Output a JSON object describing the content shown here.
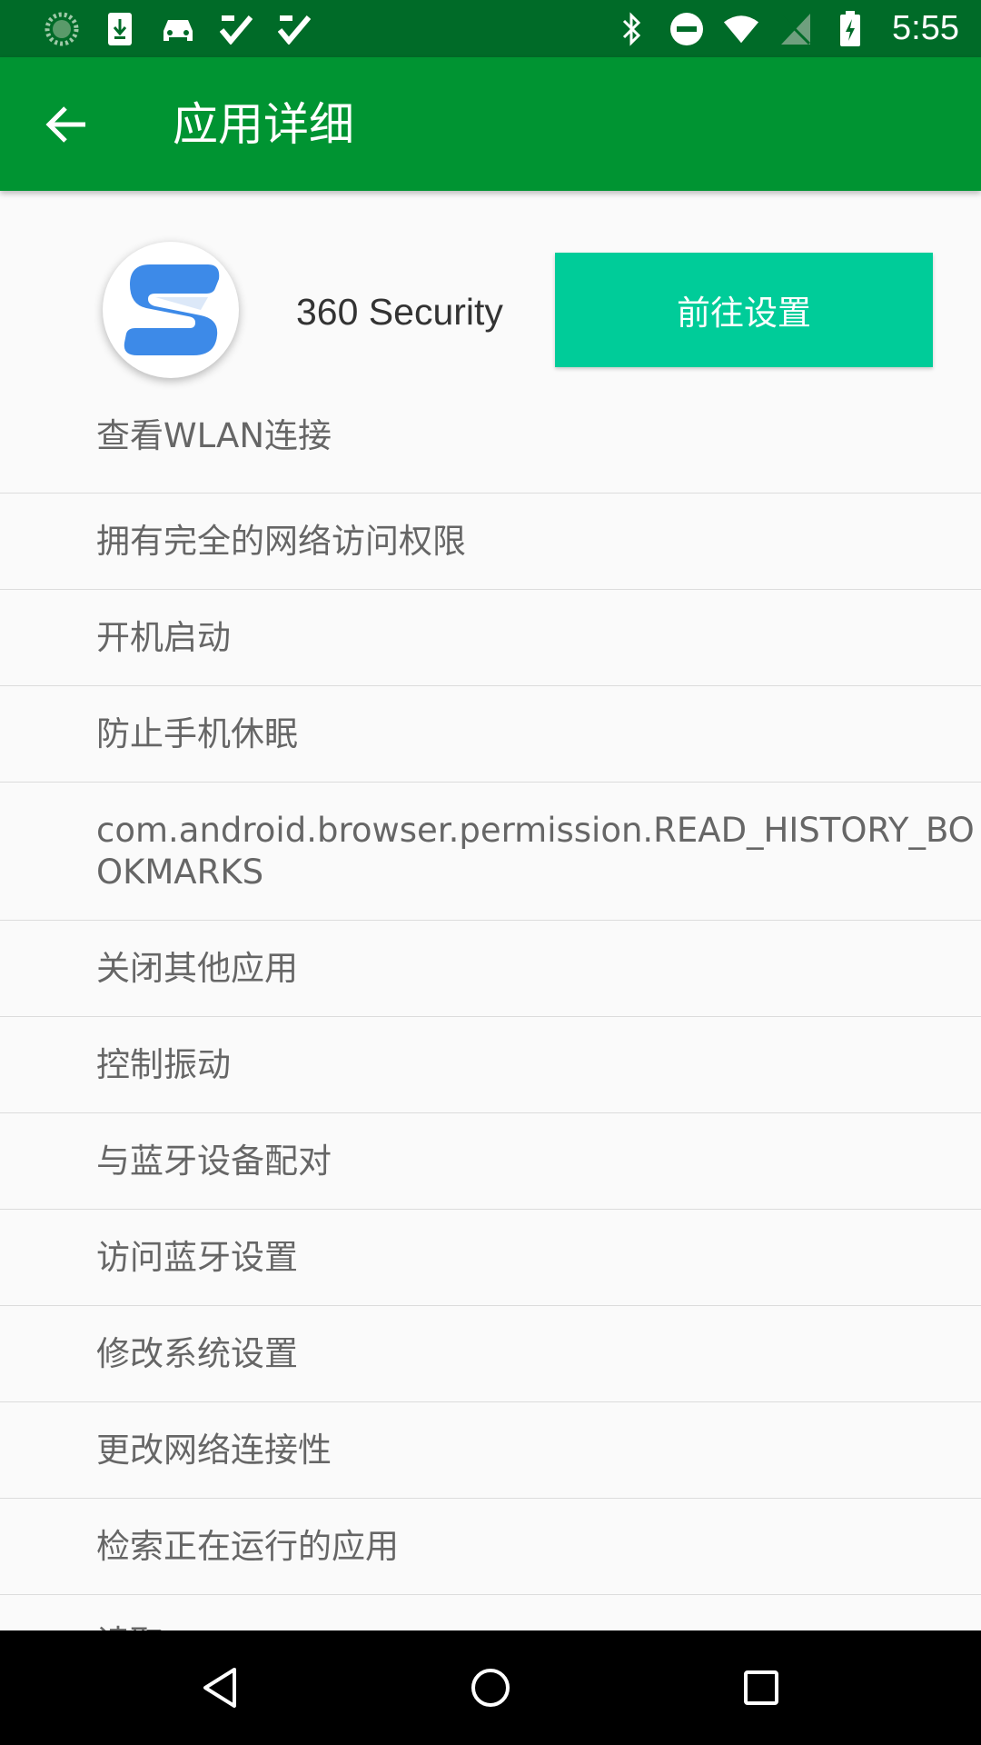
{
  "status_bar": {
    "time": "5:55",
    "left_icons": [
      "loading-icon",
      "download-icon",
      "car-icon",
      "check-icon",
      "check-icon"
    ],
    "right_icons": [
      "bluetooth-icon",
      "do-not-disturb-icon",
      "wifi-icon",
      "no-sim-icon",
      "battery-charging-icon"
    ]
  },
  "app_bar": {
    "title": "应用详细",
    "color": "#009432"
  },
  "header": {
    "app_name": "360 Security",
    "goto_button_label": "前往设置",
    "button_color": "#00cc99"
  },
  "permissions": [
    "查看WLAN连接",
    "拥有完全的网络访问权限",
    "开机启动",
    "防止手机休眠",
    "com.android.browser.permission.READ_HISTORY_BOOKMARKS",
    "关闭其他应用",
    "控制振动",
    "与蓝牙设备配对",
    "访问蓝牙设置",
    "修改系统设置",
    "更改网络连接性",
    "检索正在运行的应用",
    "读取"
  ]
}
